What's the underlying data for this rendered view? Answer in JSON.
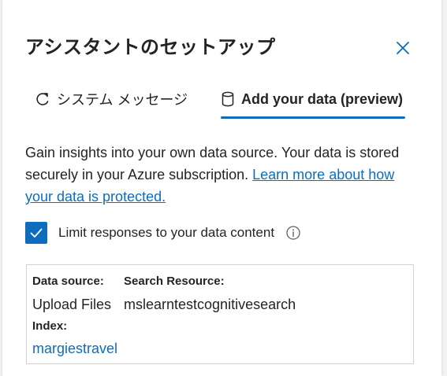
{
  "panel": {
    "title": "アシスタントのセットアップ",
    "close_icon": "close-icon"
  },
  "tabs": [
    {
      "label": "システム メッセージ",
      "icon": "system-message-icon",
      "selected": false
    },
    {
      "label": "Add your data (preview)",
      "icon": "database-icon",
      "selected": true
    }
  ],
  "description": {
    "text": "Gain insights into your own data source. Your data is stored securely in your Azure subscription. ",
    "link": "Learn more about how your data is protected."
  },
  "limit_checkbox": {
    "label": "Limit responses to your data content",
    "checked": true,
    "info_icon": "info-icon"
  },
  "data_source": {
    "data_source_label": "Data source:",
    "data_source_value": "Upload Files",
    "search_resource_label": "Search Resource:",
    "search_resource_value": "mslearntestcognitivesearch",
    "index_label": "Index:",
    "index_value": "margiestravel"
  },
  "colors": {
    "accent": "#0f6cbd",
    "text": "#242424",
    "border": "#d1d1d1"
  }
}
